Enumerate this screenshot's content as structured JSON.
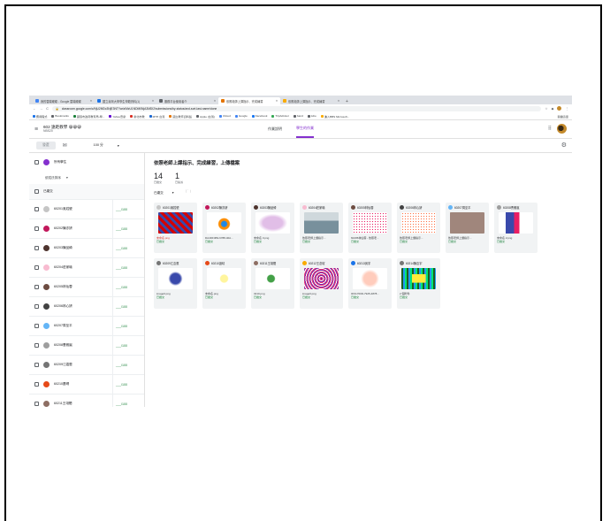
{
  "browser": {
    "tabs": [
      {
        "label": "我的雲端硬碟 - Google 雲端硬碟",
        "color": "#4285f4",
        "active": false
      },
      {
        "label": "國立臺灣大學學生學籍資料(1)",
        "color": "#1a73e8",
        "active": false
      },
      {
        "label": "服務平台使用者介",
        "color": "#5f6368",
        "active": false
      },
      {
        "label": "依照老師上課指示、完成練習",
        "color": "#e37400",
        "active": true
      },
      {
        "label": "依照老師上課指示、完成練習",
        "color": "#f9ab00",
        "active": false
      }
    ],
    "new_tab": "+",
    "url": "classroom.google.com/c/NjU2MDc3NjE3NTYw/a/MzU1NDM0NjA3MDI2/submissions/by-status/and-sort-last-name/done",
    "bookmarks": [
      {
        "label": "應用程式",
        "color": "#1a73e8"
      },
      {
        "label": "Bookmarks",
        "color": "#5f6368"
      },
      {
        "label": "國環市政府教育局-學...",
        "color": "#188038"
      },
      {
        "label": "Yahoo奇摩",
        "color": "#6001d2"
      },
      {
        "label": "新北市教",
        "color": "#d93025"
      },
      {
        "label": "MTH 台灣",
        "color": "#1967d2"
      },
      {
        "label": "國立教育資料館",
        "color": "#e37400"
      },
      {
        "label": "Apple (台灣)",
        "color": "#5f6368"
      },
      {
        "label": "iCloud",
        "color": "#4285f4"
      },
      {
        "label": "Google",
        "color": "#4285f4"
      },
      {
        "label": "Facebook",
        "color": "#1877f2"
      },
      {
        "label": "TripAdvisor",
        "color": "#34a853"
      },
      {
        "label": "band",
        "color": "#5f6368"
      },
      {
        "label": "tube",
        "color": "#5f6368"
      },
      {
        "label": "進入BBS Microsoft...",
        "color": "#f9ab00"
      }
    ],
    "reading_list": "閱讀清單"
  },
  "classroom": {
    "course_title": "602 遠距教學 😀😀😀",
    "course_sub": "NBS20",
    "tabs": [
      {
        "label": "作業說明",
        "active": false
      },
      {
        "label": "學生的作業",
        "active": true
      }
    ]
  },
  "toolbar": {
    "return_label": "發還",
    "points_label": "100 分",
    "points_caret": "▾"
  },
  "left": {
    "all_students": "所有學生",
    "sort_label": "依姓氏排序",
    "sort_caret": "▾",
    "section_label": "已繳交",
    "students": [
      {
        "name": "60201吳姓號",
        "grade": "___/100",
        "color": "#c5c5c5"
      },
      {
        "name": "60202陳亦妍",
        "grade": "___/100",
        "color": "#c2185b"
      },
      {
        "name": "60203陳品綺",
        "grade": "___/100",
        "color": "#4e342e"
      },
      {
        "name": "60204莊家瑜",
        "grade": "___/100",
        "color": "#f8bbd0"
      },
      {
        "name": "60205林仙蓉",
        "grade": "___/100",
        "color": "#6d4c41"
      },
      {
        "name": "60206林心妍",
        "grade": "___/100",
        "color": "#424242"
      },
      {
        "name": "60207周至平",
        "grade": "___/100",
        "color": "#64b5f6"
      },
      {
        "name": "60208曹雅嵐",
        "grade": "___/100",
        "color": "#9e9e9e"
      },
      {
        "name": "60209江嘉蕙",
        "grade": "___/100",
        "color": "#757575"
      },
      {
        "name": "60210蕭晴",
        "grade": "___/100",
        "color": "#e64a19"
      },
      {
        "name": "60211王翊閎",
        "grade": "___/100",
        "color": "#8d6e63"
      }
    ]
  },
  "assignment": {
    "title": "依照老師上課指示、完成練習，上傳檔案",
    "submitted_count": "14",
    "submitted_label": "已繳交",
    "assigned_count": "1",
    "assigned_label": "已指派",
    "filter_label": "已繳交",
    "filter_caret": "▾",
    "cards": [
      {
        "name": "60201吳姓號",
        "file": "未命名.png",
        "status": "已繳交",
        "late": true,
        "color": "#c5c5c5",
        "thumb": "thumb-red"
      },
      {
        "name": "60202陳亦妍",
        "file": "DA4DF4B3-6788-40A...",
        "status": "已繳交",
        "late": false,
        "color": "#c2185b",
        "thumb": "thumb-spot"
      },
      {
        "name": "60203陳品綺",
        "file": "未命名 3.png",
        "status": "已繳交",
        "late": false,
        "color": "#4e342e",
        "thumb": "thumb-pink"
      },
      {
        "name": "60204莊家瑜",
        "file": "依照老師上課指示...",
        "status": "已繳交",
        "late": false,
        "color": "#f8bbd0",
        "thumb": "thumb-photo"
      },
      {
        "name": "60205林仙蓉",
        "file": "60205林仙蓉 - 依照老...",
        "status": "已繳交",
        "late": false,
        "color": "#6d4c41",
        "thumb": "thumb-dots"
      },
      {
        "name": "60206林心妍",
        "file": "依照老師上課指示...",
        "status": "已繳交",
        "late": false,
        "color": "#424242",
        "thumb": "thumb-dots2"
      },
      {
        "name": "60207周至平",
        "file": "依照老師上課指示...",
        "status": "已繳交",
        "late": false,
        "color": "#64b5f6",
        "thumb": "thumb-photo2"
      },
      {
        "name": "60208曹雅嵐",
        "file": "未命名 2.png",
        "status": "已繳交",
        "late": false,
        "color": "#9e9e9e",
        "thumb": "thumb-flag"
      },
      {
        "name": "60209江嘉蕙",
        "file": "image0.png",
        "status": "已繳交",
        "late": false,
        "color": "#757575",
        "thumb": "thumb-blue"
      },
      {
        "name": "60210蕭晴",
        "file": "未命名.png",
        "status": "已繳交",
        "late": false,
        "color": "#e64a19",
        "thumb": "thumb-plain"
      },
      {
        "name": "60211王翊閎",
        "file": "3210.png",
        "status": "已繳交",
        "late": false,
        "color": "#8d6e63",
        "thumb": "thumb-tree"
      },
      {
        "name": "60212王念瑄",
        "file": "image0.png",
        "status": "已繳交",
        "late": false,
        "color": "#f9ab00",
        "thumb": "thumb-purple"
      },
      {
        "name": "60213黃宇",
        "file": "0F31700D-7925-4878...",
        "status": "已繳交",
        "late": false,
        "color": "#1a73e8",
        "thumb": "thumb-orange"
      },
      {
        "name": "60214陳嘉宇",
        "file": "2 個附件",
        "status": "已繳交",
        "late": false,
        "color": "#757575",
        "thumb": "thumb-green"
      }
    ]
  }
}
